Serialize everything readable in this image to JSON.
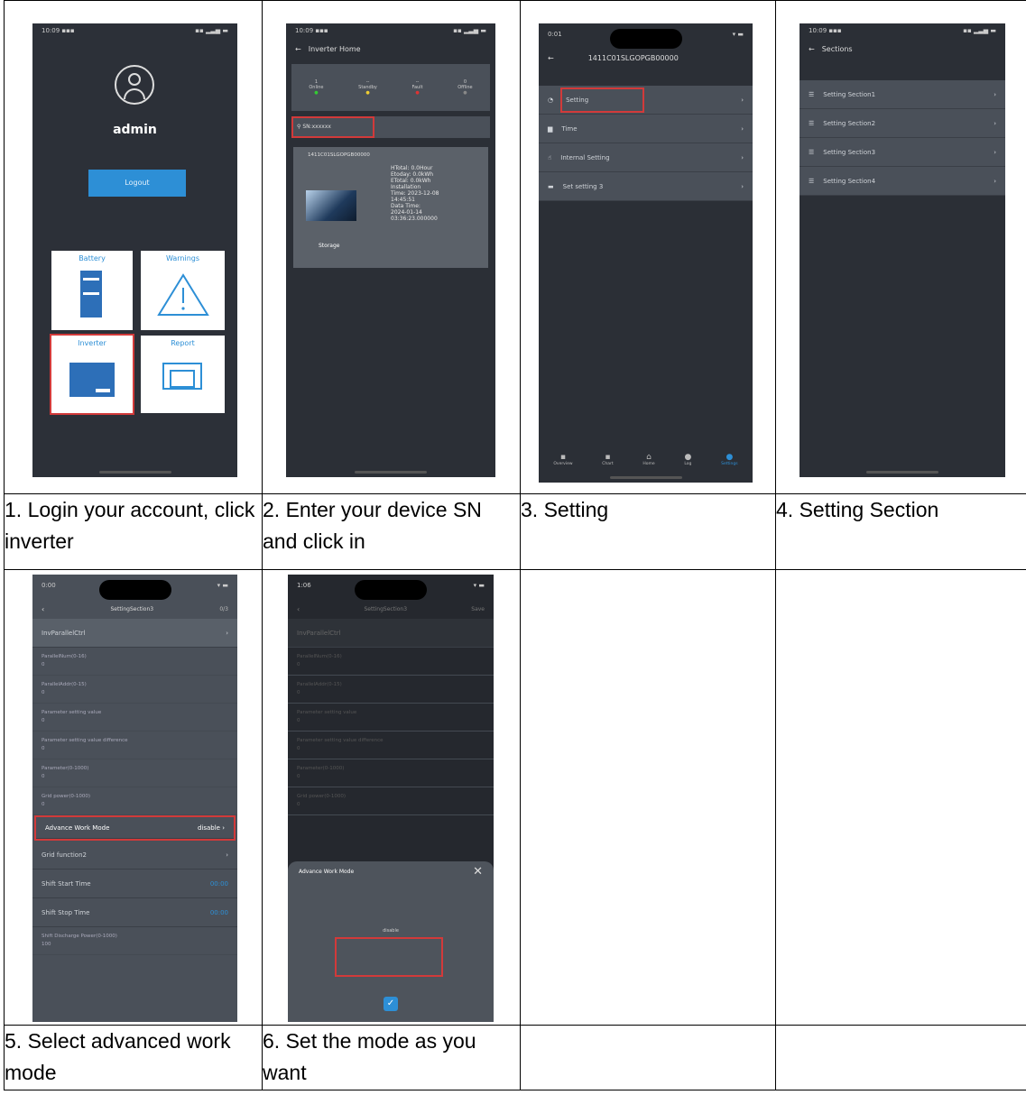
{
  "captions": {
    "step1": "1. Login your account, click inverter",
    "step2": "2. Enter your device SN and click in",
    "step3": "3. Setting",
    "step4": "4. Setting Section",
    "step5": "5. Select advanced work mode",
    "step6": "6. Set the mode as you want"
  },
  "screen1": {
    "username": "admin",
    "logout": "Logout",
    "tiles": [
      "Battery",
      "Warnings",
      "Inverter",
      "Report"
    ]
  },
  "screen2": {
    "title": "Inverter Home",
    "stats": [
      "Online",
      "Standby",
      "Fault",
      "Offline"
    ],
    "device_sn": "1411C01SLGOPGB00000",
    "device_type": "Storage"
  },
  "screen3": {
    "title": "1411C01SLGOPGB00000",
    "menu": [
      "Setting",
      "Time",
      "Internal Setting",
      "Set setting 3"
    ],
    "nav": [
      "Overview",
      "Chart",
      "Home",
      "Log",
      "Settings"
    ]
  },
  "screen4": {
    "title": "Sections",
    "sections": [
      "Setting Section1",
      "Setting Section2",
      "Setting Section3",
      "Setting Section4"
    ]
  },
  "screen5": {
    "time": "0:00",
    "title": "SettingSection3",
    "header_row": "InvParallelCtrl",
    "highlight_row": "Advance Work Mode",
    "highlight_value": "disable",
    "rows_after": [
      "Grid function2",
      "Shift Start Time",
      "Shift Stop Time"
    ]
  },
  "screen6": {
    "time": "1:06",
    "title": "SettingSection3",
    "save": "Save",
    "header_row": "InvParallelCtrl",
    "dialog_title": "Advance Work Mode",
    "option": "disable"
  },
  "colors": {
    "accent": "#2d8fd6",
    "highlight": "#d23a3a",
    "phone_bg": "#2b2f36"
  }
}
